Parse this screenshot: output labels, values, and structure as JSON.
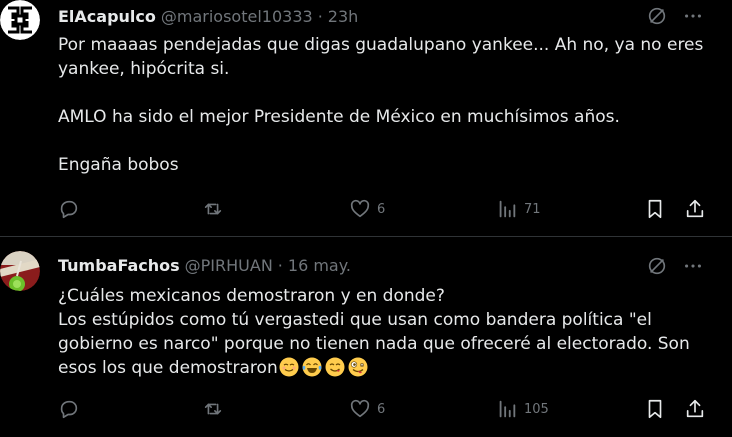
{
  "tweets": [
    {
      "name": "ElAcapulco",
      "handle": "@mariosotel10333",
      "separator": "·",
      "time": "23h",
      "text_lines": [
        "Por maaaas pendejadas que digas guadalupano yankee... Ah no, ya no eres",
        "yankee, hipócrita si.",
        "AMLO ha sido el mejor Presidente de México en muchísimos años.",
        "Engaña bobos"
      ],
      "likes": "6",
      "views": "71",
      "colors": {
        "avatar_bg": "#ffffff",
        "avatar_glyph": "#000000"
      }
    },
    {
      "name": "TumbaFachos",
      "handle": "@PIRHUAN",
      "separator": "·",
      "time": "16 may.",
      "text_lines": [
        "¿Cuáles mexicanos demostraron y en donde?",
        "Los estúpidos como tú vergastedi que usan como bandera política \"el",
        "gobierno es narco\" porque no tienen nada que ofreceré al electorado. Son",
        "esos los que demostraron"
      ],
      "emojis": [
        "relieved-smile-emoji",
        "tears-of-joy-emoji",
        "yum-face-emoji",
        "zany-face-emoji"
      ],
      "likes": "6",
      "views": "105",
      "colors": {
        "avatar_bg": "#c0392b",
        "avatar_accent": "#6cbf2a"
      }
    }
  ],
  "icons": [
    "grok-icon",
    "more-icon",
    "reply-icon",
    "retweet-icon",
    "like-icon",
    "views-icon",
    "bookmark-icon",
    "share-icon"
  ],
  "colors": {
    "background": "#000000",
    "text": "#e7e9ea",
    "muted": "#71767b",
    "divider": "#2f3336"
  }
}
